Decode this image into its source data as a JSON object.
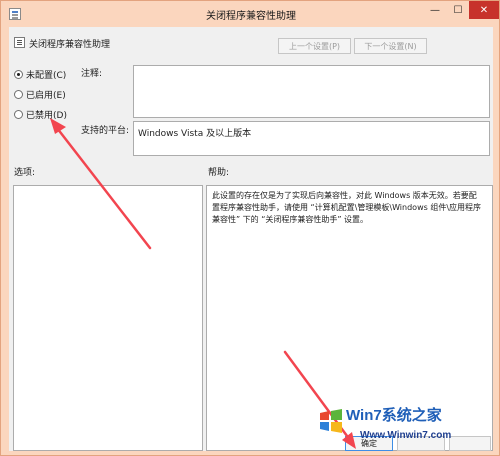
{
  "window": {
    "title": "关闭程序兼容性助理",
    "minimize_glyph": "—",
    "maximize_glyph": "☐",
    "close_glyph": "✕"
  },
  "header": {
    "policy_name": "关闭程序兼容性助理",
    "prev_button": "上一个设置(P)",
    "next_button": "下一个设置(N)"
  },
  "state": {
    "options": [
      {
        "label": "未配置(C)",
        "checked": true
      },
      {
        "label": "已启用(E)",
        "checked": false
      },
      {
        "label": "已禁用(D)",
        "checked": false
      }
    ]
  },
  "comment": {
    "label": "注释:",
    "value": ""
  },
  "platform": {
    "label": "支持的平台:",
    "value": "Windows Vista 及以上版本"
  },
  "options_panel": {
    "label": "选项:"
  },
  "help_panel": {
    "label": "帮助:",
    "text": "此设置的存在仅是为了实现后向兼容性，对此 Windows 版本无效。若要配置程序兼容性助手，请使用 “计算机配置\\管理模板\\Windows 组件\\应用程序兼容性” 下的 “关闭程序兼容性助手” 设置。"
  },
  "footer": {
    "ok_button": "确定",
    "cancel_button": "",
    "apply_button": ""
  },
  "watermark": {
    "title": "Win7系统之家",
    "url": "Www.Winwin7.com"
  },
  "colors": {
    "frame": "#fbd6be",
    "client": "#f0f0f0",
    "close": "#c7322b",
    "arrow": "#f2454f"
  },
  "icons": [
    "app-icon",
    "policy-icon",
    "minimize-icon",
    "maximize-icon",
    "close-icon",
    "windows-logo-icon"
  ]
}
